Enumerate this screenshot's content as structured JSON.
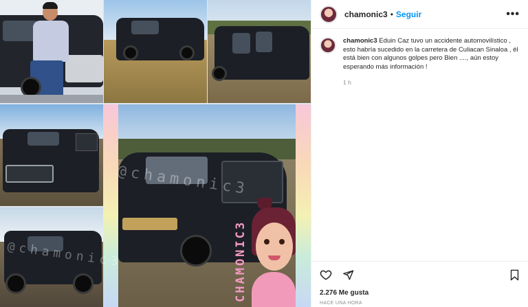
{
  "post": {
    "username": "chamonic3",
    "separator": "•",
    "follow_label": "Seguir",
    "more_icon": "more-horizontal-icon",
    "caption_user": "chamonic3",
    "caption_text": "Eduin Caz tuvo un accidente automovilístico , esto habría sucedido en la carretera de Culiacan Sinaloa , él está bien con algunos golpes pero Bien ...., aún estoy esperando más información !",
    "caption_time": "1 h",
    "likes": "2.276 Me gusta",
    "posted_ago": "HACE UNA HORA",
    "watermark_text": "@chamonic3",
    "brand_text": "CHAMONIC3"
  },
  "icons": {
    "like": "heart-icon",
    "share": "send-icon",
    "save": "bookmark-icon"
  },
  "colors": {
    "follow": "#0095f6",
    "brand_pink": "#f39ac2",
    "muted": "#8e8e8e"
  }
}
